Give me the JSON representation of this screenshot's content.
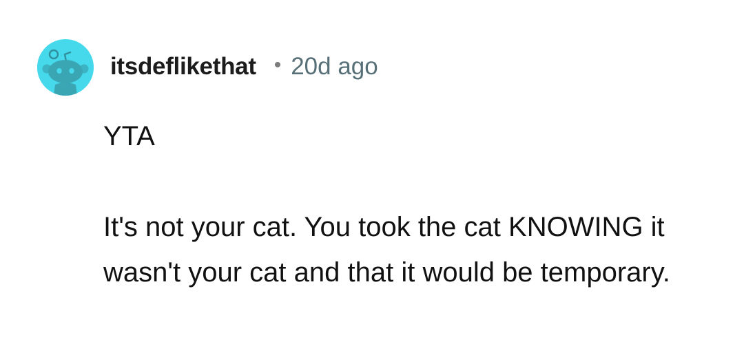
{
  "comment": {
    "author": "itsdeflikethat",
    "separator": "•",
    "age": "20d ago",
    "avatar_icon": "reddit-snoo-avatar-icon",
    "avatar_color": "#46d9ec",
    "paragraphs": [
      "YTA",
      "It's not your cat. You took the cat KNOWING it wasn't your cat and that it would be temporary."
    ]
  }
}
